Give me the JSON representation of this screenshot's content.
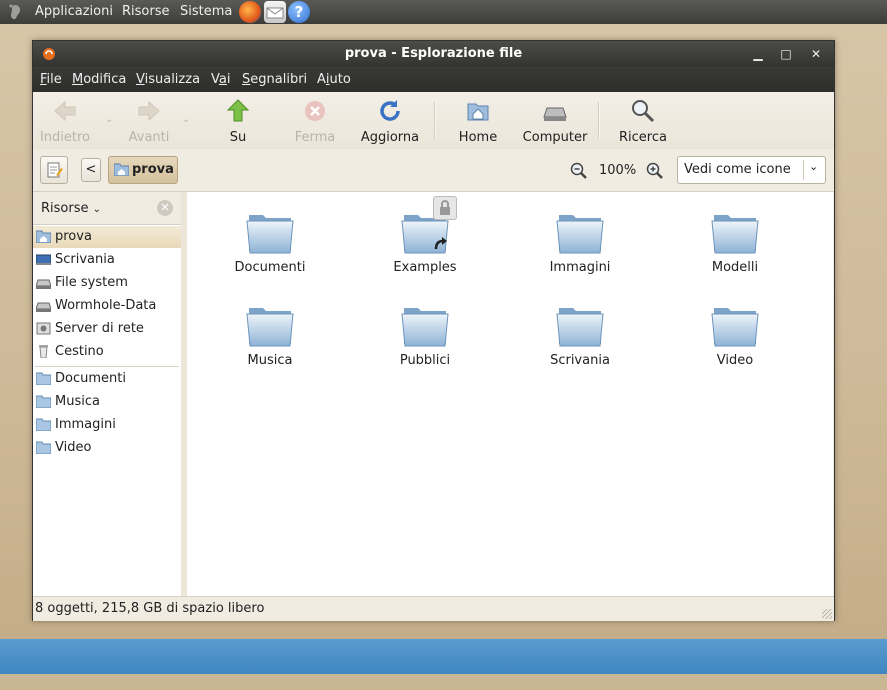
{
  "panel": {
    "menus": [
      "Applicazioni",
      "Risorse",
      "Sistema"
    ],
    "launchers": [
      "firefox-icon",
      "mail-icon",
      "help-icon"
    ]
  },
  "window": {
    "title": "prova - Esplorazione file",
    "controls": {
      "minimize": "▁",
      "maximize": "□",
      "close": "✕"
    }
  },
  "menubar": [
    {
      "label": "File",
      "mnemonic": "F",
      "rest": "ile"
    },
    {
      "label": "Modifica",
      "mnemonic": "M",
      "rest": "odifica"
    },
    {
      "label": "Visualizza",
      "mnemonic": "V",
      "rest": "isualizza"
    },
    {
      "label": "Vai",
      "pre": "V",
      "mnemonic": "a",
      "rest": "i"
    },
    {
      "label": "Segnalibri",
      "pre": "",
      "mnemonic": "S",
      "rest": "egnalibri"
    },
    {
      "label": "Aiuto",
      "pre": "A",
      "mnemonic": "i",
      "rest": "uto"
    }
  ],
  "toolbar": {
    "back": "Indietro",
    "forward": "Avanti",
    "up": "Su",
    "stop": "Ferma",
    "reload": "Aggiorna",
    "home": "Home",
    "computer": "Computer",
    "search": "Ricerca"
  },
  "location": {
    "crumb": "prova",
    "zoom": "100%",
    "view_mode": "Vedi come icone"
  },
  "sidebar": {
    "header": "Risorse",
    "places": [
      {
        "label": "prova",
        "icon": "home-folder-icon",
        "selected": true
      },
      {
        "label": "Scrivania",
        "icon": "desktop-icon"
      },
      {
        "label": "File system",
        "icon": "drive-icon"
      },
      {
        "label": "Wormhole-Data",
        "icon": "drive-icon"
      },
      {
        "label": "Server di rete",
        "icon": "network-icon"
      },
      {
        "label": "Cestino",
        "icon": "trash-icon"
      }
    ],
    "bookmarks": [
      {
        "label": "Documenti",
        "icon": "folder-icon"
      },
      {
        "label": "Musica",
        "icon": "folder-icon"
      },
      {
        "label": "Immagini",
        "icon": "folder-icon"
      },
      {
        "label": "Video",
        "icon": "folder-icon"
      }
    ]
  },
  "files": [
    {
      "name": "Documenti",
      "icon": "folder-icon"
    },
    {
      "name": "Examples",
      "icon": "folder-link-locked-icon"
    },
    {
      "name": "Immagini",
      "icon": "folder-icon"
    },
    {
      "name": "Modelli",
      "icon": "folder-icon"
    },
    {
      "name": "Musica",
      "icon": "folder-icon"
    },
    {
      "name": "Pubblici",
      "icon": "folder-icon"
    },
    {
      "name": "Scrivania",
      "icon": "folder-icon"
    },
    {
      "name": "Video",
      "icon": "folder-icon"
    }
  ],
  "status": "8 oggetti, 215,8 GB di spazio libero"
}
